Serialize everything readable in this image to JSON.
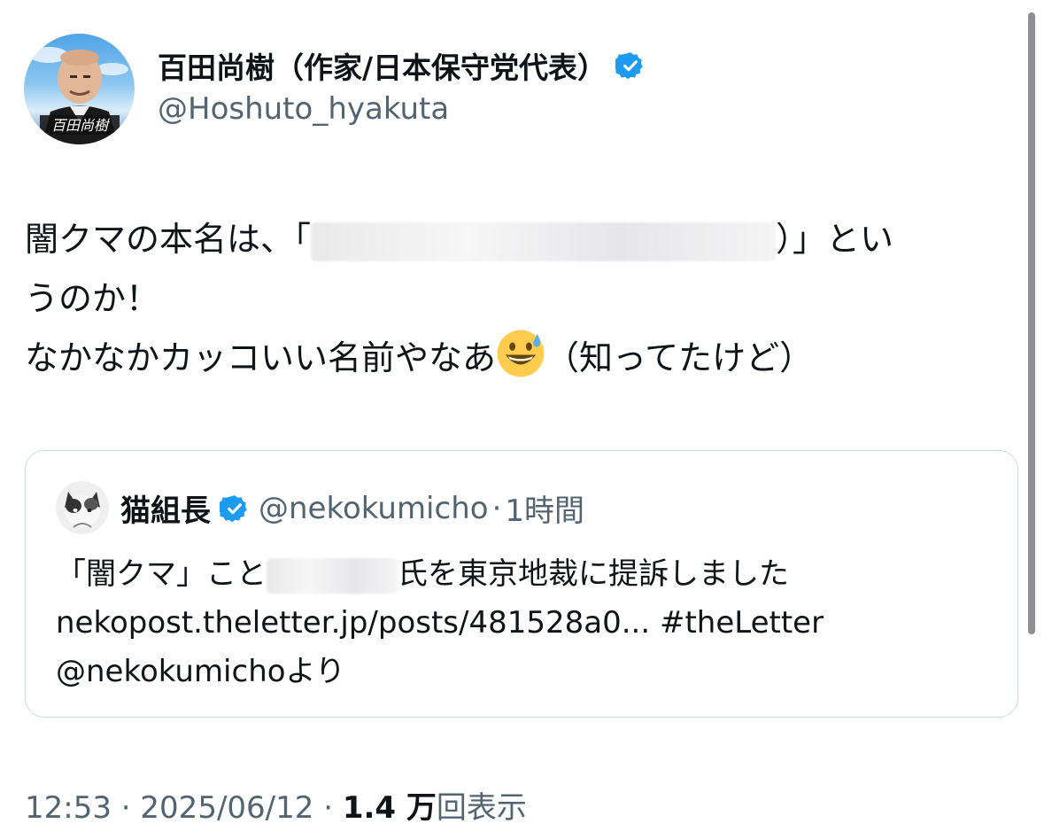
{
  "author": {
    "display_name": "百田尚樹（作家/日本保守党代表）",
    "handle": "@Hoshuto_hyakuta",
    "avatar_caption": "百田尚樹"
  },
  "tweet": {
    "line1_prefix": "闇クマの本名は、「",
    "line1_suffix": "）」とい",
    "line2": "うのか！",
    "line3_prefix": "なかなかカッコいい名前やなあ",
    "line3_suffix": "（知ってたけど）",
    "emoji_icon": "grinning-face-with-sweat-icon"
  },
  "quoted": {
    "name": "猫組長",
    "handle": "@nekokumicho",
    "separator": "·",
    "time": "1時間",
    "line1_prefix": "「闇クマ」こと",
    "line1_suffix": "氏を東京地裁に提訴しました",
    "line2": "nekopost.theletter.jp/posts/481528a0... #theLetter",
    "line3": "@nekokumichoより"
  },
  "footer": {
    "time": "12:53",
    "sep1": " · ",
    "date": "2025/06/12",
    "sep2": " · ",
    "views_count": "1.4 万",
    "views_label": "回表示"
  },
  "colors": {
    "verified": "#1d9bf0",
    "secondary_text": "#536471",
    "primary_text": "#0f1419",
    "border": "#cfd9de"
  }
}
